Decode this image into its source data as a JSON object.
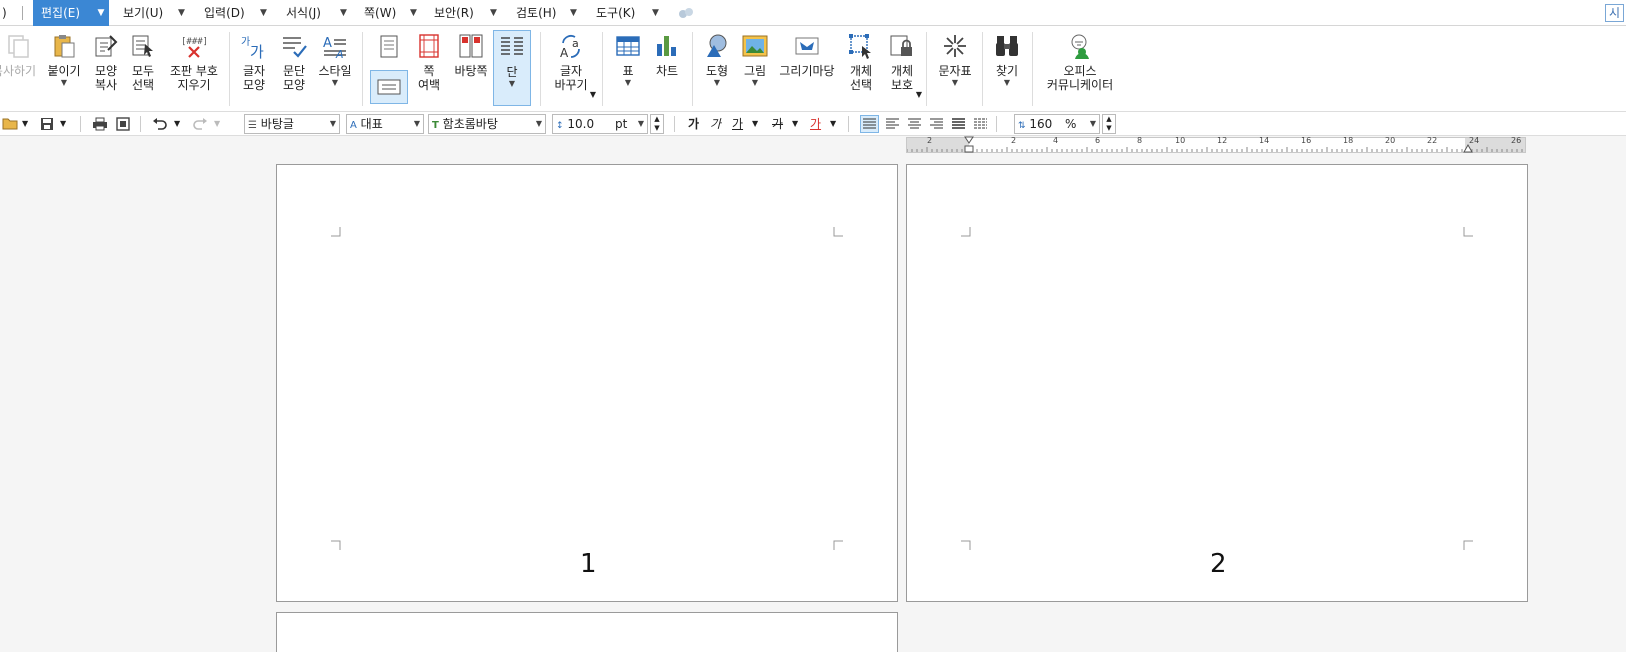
{
  "menubar": {
    "left_fragment": ")",
    "items": [
      {
        "label": "편집(E)"
      },
      {
        "label": "보기(U)"
      },
      {
        "label": "입력(D)"
      },
      {
        "label": "서식(J)"
      },
      {
        "label": "쪽(W)"
      },
      {
        "label": "보안(R)"
      },
      {
        "label": "검토(H)"
      },
      {
        "label": "도구(K)"
      }
    ],
    "right_fragment": "시"
  },
  "ribbon": {
    "copy_partial": "복사하기",
    "paste": "붙이기",
    "format_copy": [
      "모양",
      "복사"
    ],
    "select_all": [
      "모두",
      "선택"
    ],
    "clear_marks": [
      "조판 부호",
      "지우기"
    ],
    "char_shape": [
      "글자",
      "모양"
    ],
    "para_shape": [
      "문단",
      "모양"
    ],
    "style": "스타일",
    "page_margin": [
      "쪽",
      "여백"
    ],
    "background_page": "바탕쪽",
    "column": "단",
    "char_replace": [
      "글자",
      "바꾸기"
    ],
    "table": "표",
    "chart": "차트",
    "shape": "도형",
    "picture": "그림",
    "drawing_art": "그리기마당",
    "object_select": [
      "개체",
      "선택"
    ],
    "object_protect": [
      "개체",
      "보호"
    ],
    "symbols": "문자표",
    "find": "찾기",
    "office_comm": [
      "오피스",
      "커뮤니케이터"
    ]
  },
  "toolbar": {
    "style_value": "바탕글",
    "lang_value": "대표",
    "font_value": "함초롬바탕",
    "size_value": "10.0",
    "size_unit": "pt",
    "bold_glyph": "가",
    "italic_glyph": "가",
    "underline_glyph": "가",
    "strike_glyph": "가",
    "color_glyph": "가",
    "linespacing_value": "160",
    "linespacing_unit": "%"
  },
  "ruler": {
    "ticks": [
      "2",
      "2",
      "4",
      "6",
      "8",
      "10",
      "12",
      "14",
      "16",
      "18",
      "20",
      "22",
      "24",
      "26"
    ]
  },
  "pages": [
    {
      "number": "1"
    },
    {
      "number": "2"
    }
  ],
  "colors": {
    "accent": "#3b87d4",
    "page_border": "#9a9a9a"
  }
}
